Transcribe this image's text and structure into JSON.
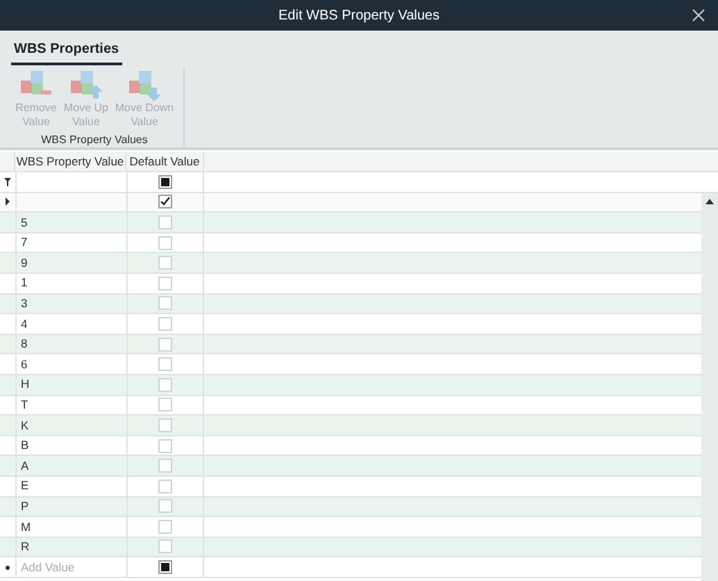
{
  "window": {
    "title": "Edit WBS Property Values"
  },
  "ribbon": {
    "tabs": [
      {
        "label": "WBS Properties",
        "selected": true
      }
    ],
    "buttons": [
      {
        "label": "Remove Value",
        "kind": "remove",
        "disabled": true
      },
      {
        "label": "Move Up Value",
        "kind": "up",
        "disabled": true
      },
      {
        "label": "Move Down Value",
        "kind": "down",
        "disabled": true
      }
    ],
    "group_label": "WBS Property Values"
  },
  "table": {
    "columns": [
      "WBS Property Value",
      "Default Value"
    ],
    "filter_row": {
      "default_indeterminate": true
    },
    "current_row": {
      "default_checked": true
    },
    "rows": [
      {
        "value": "5",
        "default_checked": false
      },
      {
        "value": "7",
        "default_checked": false
      },
      {
        "value": "9",
        "default_checked": false
      },
      {
        "value": "1",
        "default_checked": false
      },
      {
        "value": "3",
        "default_checked": false
      },
      {
        "value": "4",
        "default_checked": false
      },
      {
        "value": "8",
        "default_checked": false
      },
      {
        "value": "6",
        "default_checked": false
      },
      {
        "value": "H",
        "default_checked": false
      },
      {
        "value": "T",
        "default_checked": false
      },
      {
        "value": "K",
        "default_checked": false
      },
      {
        "value": "B",
        "default_checked": false
      },
      {
        "value": "A",
        "default_checked": false
      },
      {
        "value": "E",
        "default_checked": false
      },
      {
        "value": "P",
        "default_checked": false
      },
      {
        "value": "M",
        "default_checked": false
      },
      {
        "value": "R",
        "default_checked": false
      }
    ],
    "new_row": {
      "placeholder": "Add Value",
      "default_indeterminate": true
    }
  }
}
